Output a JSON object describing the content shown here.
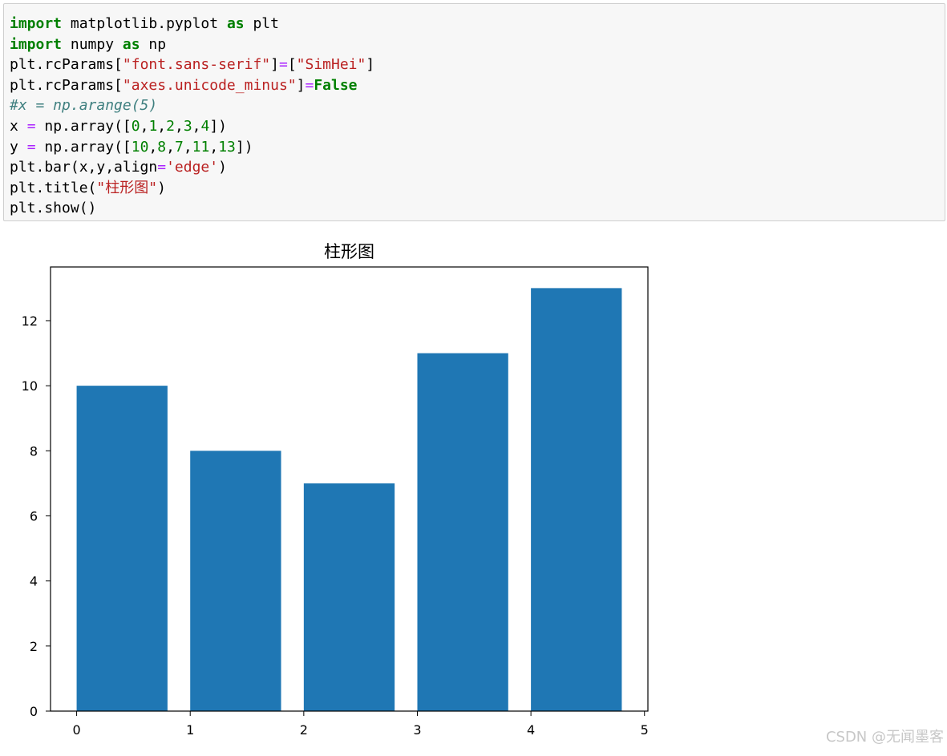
{
  "code": {
    "lines": [
      [
        {
          "t": "import",
          "c": "kw"
        },
        {
          "t": " matplotlib.pyplot ",
          "c": ""
        },
        {
          "t": "as",
          "c": "kw"
        },
        {
          "t": " plt",
          "c": ""
        }
      ],
      [
        {
          "t": "import",
          "c": "kw"
        },
        {
          "t": " numpy ",
          "c": ""
        },
        {
          "t": "as",
          "c": "kw"
        },
        {
          "t": " np",
          "c": ""
        }
      ],
      [
        {
          "t": "plt.rcParams[",
          "c": ""
        },
        {
          "t": "\"font.sans-serif\"",
          "c": "str"
        },
        {
          "t": "]",
          "c": ""
        },
        {
          "t": "=",
          "c": "op"
        },
        {
          "t": "[",
          "c": ""
        },
        {
          "t": "\"SimHei\"",
          "c": "str"
        },
        {
          "t": "]",
          "c": ""
        }
      ],
      [
        {
          "t": "plt.rcParams[",
          "c": ""
        },
        {
          "t": "\"axes.unicode_minus\"",
          "c": "str"
        },
        {
          "t": "]",
          "c": ""
        },
        {
          "t": "=",
          "c": "op"
        },
        {
          "t": "False",
          "c": "kw"
        }
      ],
      [
        {
          "t": "#x = np.arange(5)",
          "c": "cm"
        }
      ],
      [
        {
          "t": "x ",
          "c": ""
        },
        {
          "t": "=",
          "c": "op"
        },
        {
          "t": " np.array([",
          "c": ""
        },
        {
          "t": "0",
          "c": "num"
        },
        {
          "t": ",",
          "c": ""
        },
        {
          "t": "1",
          "c": "num"
        },
        {
          "t": ",",
          "c": ""
        },
        {
          "t": "2",
          "c": "num"
        },
        {
          "t": ",",
          "c": ""
        },
        {
          "t": "3",
          "c": "num"
        },
        {
          "t": ",",
          "c": ""
        },
        {
          "t": "4",
          "c": "num"
        },
        {
          "t": "])",
          "c": ""
        }
      ],
      [
        {
          "t": "y ",
          "c": ""
        },
        {
          "t": "=",
          "c": "op"
        },
        {
          "t": " np.array([",
          "c": ""
        },
        {
          "t": "10",
          "c": "num"
        },
        {
          "t": ",",
          "c": ""
        },
        {
          "t": "8",
          "c": "num"
        },
        {
          "t": ",",
          "c": ""
        },
        {
          "t": "7",
          "c": "num"
        },
        {
          "t": ",",
          "c": ""
        },
        {
          "t": "11",
          "c": "num"
        },
        {
          "t": ",",
          "c": ""
        },
        {
          "t": "13",
          "c": "num"
        },
        {
          "t": "])",
          "c": ""
        }
      ],
      [
        {
          "t": "plt.bar(x,y,align",
          "c": ""
        },
        {
          "t": "=",
          "c": "op"
        },
        {
          "t": "'edge'",
          "c": "str"
        },
        {
          "t": ")",
          "c": ""
        }
      ],
      [
        {
          "t": "plt.title(",
          "c": ""
        },
        {
          "t": "\"柱形图\"",
          "c": "str"
        },
        {
          "t": ")",
          "c": ""
        }
      ],
      [
        {
          "t": "plt.show()",
          "c": ""
        }
      ]
    ]
  },
  "chart_data": {
    "type": "bar",
    "title": "柱形图",
    "xlabel": "",
    "ylabel": "",
    "x": [
      0,
      1,
      2,
      3,
      4
    ],
    "values": [
      10,
      8,
      7,
      11,
      13
    ],
    "bar_width": 0.8,
    "align": "edge",
    "xlim": [
      -0.23,
      5.03
    ],
    "ylim": [
      0,
      13.65
    ],
    "xticks": [
      0,
      1,
      2,
      3,
      4,
      5
    ],
    "yticks": [
      0,
      2,
      4,
      6,
      8,
      10,
      12
    ],
    "grid": false,
    "bar_color": "#1f77b4"
  },
  "watermark": "CSDN @无闻墨客"
}
